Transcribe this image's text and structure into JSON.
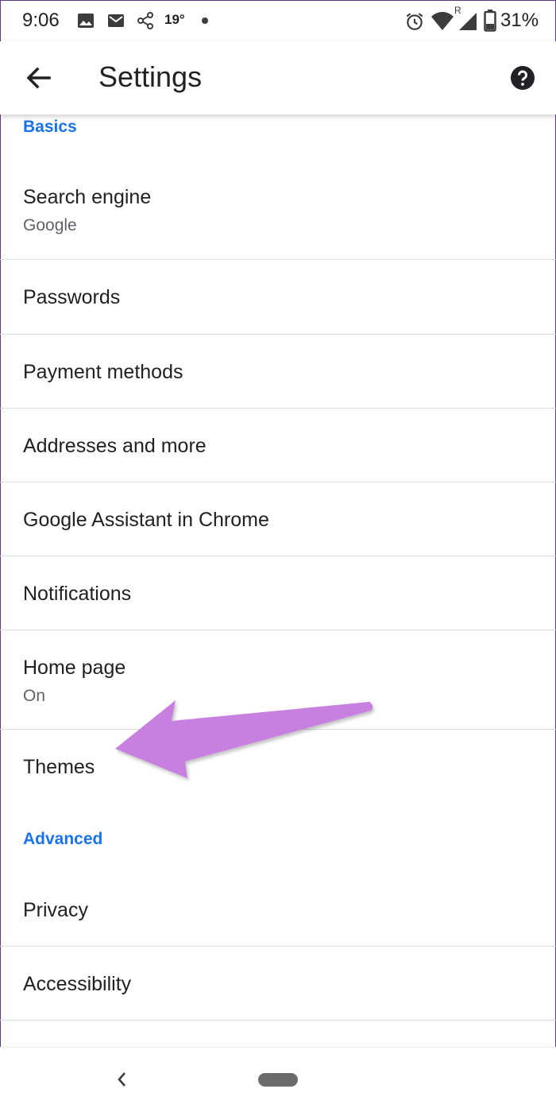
{
  "status_bar": {
    "time": "9:06",
    "temperature": "19°",
    "battery": "31%",
    "icons": [
      "image-icon",
      "gmail-icon",
      "share-icon",
      "alarm-icon",
      "wifi-icon",
      "signal-roaming-icon",
      "battery-icon"
    ]
  },
  "app_bar": {
    "title": "Settings",
    "back_icon": "arrow-back-icon",
    "help_icon": "help-icon"
  },
  "sections": {
    "basics": "Basics",
    "advanced": "Advanced"
  },
  "items": {
    "search_engine": {
      "title": "Search engine",
      "subtitle": "Google"
    },
    "passwords": {
      "title": "Passwords"
    },
    "payment_methods": {
      "title": "Payment methods"
    },
    "addresses": {
      "title": "Addresses and more"
    },
    "assistant": {
      "title": "Google Assistant in Chrome"
    },
    "notifications": {
      "title": "Notifications"
    },
    "home_page": {
      "title": "Home page",
      "subtitle": "On"
    },
    "themes": {
      "title": "Themes"
    },
    "privacy": {
      "title": "Privacy"
    },
    "accessibility": {
      "title": "Accessibility"
    }
  },
  "annotation": {
    "arrow_color": "#c77fe0",
    "points_to": "Themes"
  },
  "colors": {
    "accent": "#1a73e8",
    "text_primary": "#202124",
    "text_secondary": "#5f6368",
    "divider": "#dadce0"
  }
}
